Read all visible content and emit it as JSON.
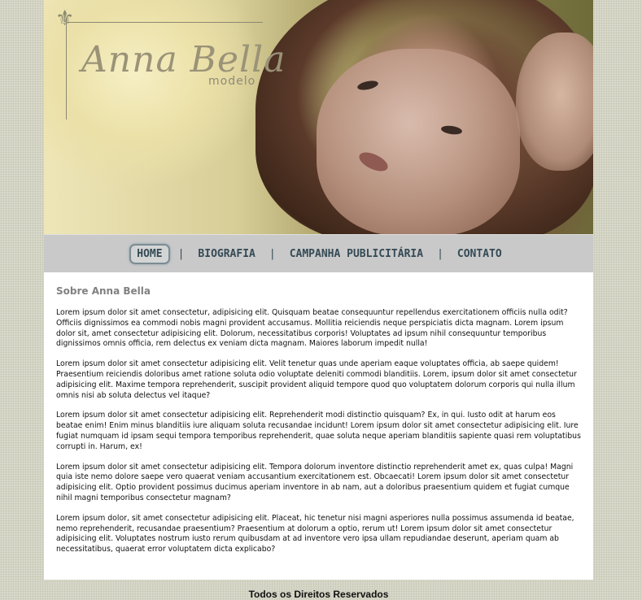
{
  "brand": {
    "name": "Anna Bella",
    "subtitle": "modelo",
    "fleur_icon": "fleur-de-lis-icon"
  },
  "nav": {
    "items": [
      {
        "label": "HOME",
        "active": true
      },
      {
        "label": "BIOGRAFIA",
        "active": false
      },
      {
        "label": "CAMPANHA PUBLICITÁRIA",
        "active": false
      },
      {
        "label": "CONTATO",
        "active": false
      }
    ],
    "separator": "|"
  },
  "main": {
    "title": "Sobre Anna Bella",
    "paragraphs": [
      "Lorem ipsum dolor sit amet consectetur, adipisicing elit. Quisquam beatae consequuntur repellendus exercitationem officiis nulla odit? Officiis dignissimos ea commodi nobis magni provident accusamus. Mollitia reiciendis neque perspiciatis dicta magnam. Lorem ipsum dolor sit, amet consectetur adipisicing elit. Dolorum, necessitatibus corporis! Voluptates ad ipsum nihil consequuntur temporibus dignissimos omnis officia, rem delectus ex veniam dicta magnam. Maiores laborum impedit nulla!",
      "Lorem ipsum dolor sit amet consectetur adipisicing elit. Velit tenetur quas unde aperiam eaque voluptates officia, ab saepe quidem! Praesentium reiciendis doloribus amet ratione soluta odio voluptate deleniti commodi blanditiis. Lorem, ipsum dolor sit amet consectetur adipisicing elit. Maxime tempora reprehenderit, suscipit provident aliquid tempore quod quo voluptatem dolorum corporis qui nulla illum omnis nisi ab soluta delectus vel itaque?",
      "Lorem ipsum dolor sit amet consectetur adipisicing elit. Reprehenderit modi distinctio quisquam? Ex, in qui. Iusto odit at harum eos beatae enim! Enim minus blanditiis iure aliquam soluta recusandae incidunt! Lorem ipsum dolor sit amet consectetur adipisicing elit. Iure fugiat numquam id ipsam sequi tempora temporibus reprehenderit, quae soluta neque aperiam blanditiis sapiente quasi rem voluptatibus corrupti in. Harum, ex!",
      "Lorem ipsum dolor sit amet consectetur adipisicing elit. Tempora dolorum inventore distinctio reprehenderit amet ex, quas culpa! Magni quia iste nemo dolore saepe vero quaerat veniam accusantium exercitationem est. Obcaecati! Lorem ipsum dolor sit amet consectetur adipisicing elit. Optio provident possimus ducimus aperiam inventore in ab nam, aut a doloribus praesentium quidem et fugiat cumque nihil magni temporibus consectetur magnam?",
      "Lorem ipsum dolor, sit amet consectetur adipisicing elit. Placeat, hic tenetur nisi magni asperiores nulla possimus assumenda id beatae, nemo reprehenderit, recusandae praesentium? Praesentium at dolorum a optio, rerum ut! Lorem ipsum dolor sit amet consectetur adipisicing elit. Voluptates nostrum iusto rerum quibusdam at ad inventore vero ipsa ullam repudiandae deserunt, aperiam quam ab necessitatibus, quaerat error voluptatem dicta explicabo?"
    ]
  },
  "footer": {
    "text": "Todos os Direitos Reservados"
  }
}
